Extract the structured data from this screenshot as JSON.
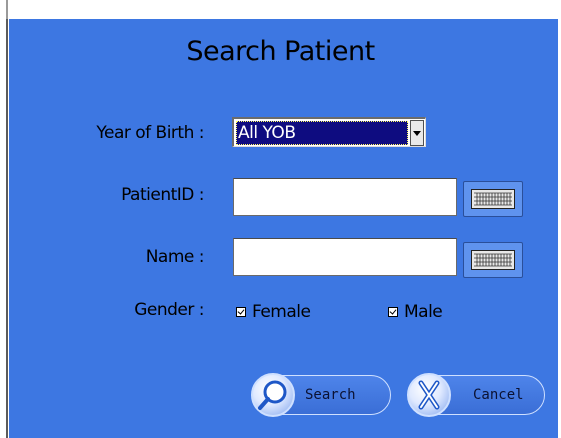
{
  "dialog": {
    "title": "Search Patient",
    "background": "#3d77e2"
  },
  "fields": {
    "yob_label": "Year of Birth :",
    "yob_value": "All YOB",
    "patient_id_label": "PatientID :",
    "patient_id_value": "",
    "name_label": "Name :",
    "name_value": "",
    "gender_label": "Gender :"
  },
  "gender": {
    "female_label": "Female",
    "female_checked": true,
    "male_label": "Male",
    "male_checked": true
  },
  "buttons": {
    "search_label": "Search",
    "search_icon": "magnifier-icon",
    "cancel_label": "Cancel",
    "cancel_icon": "x-icon",
    "keyboard_icon": "keyboard-icon"
  }
}
